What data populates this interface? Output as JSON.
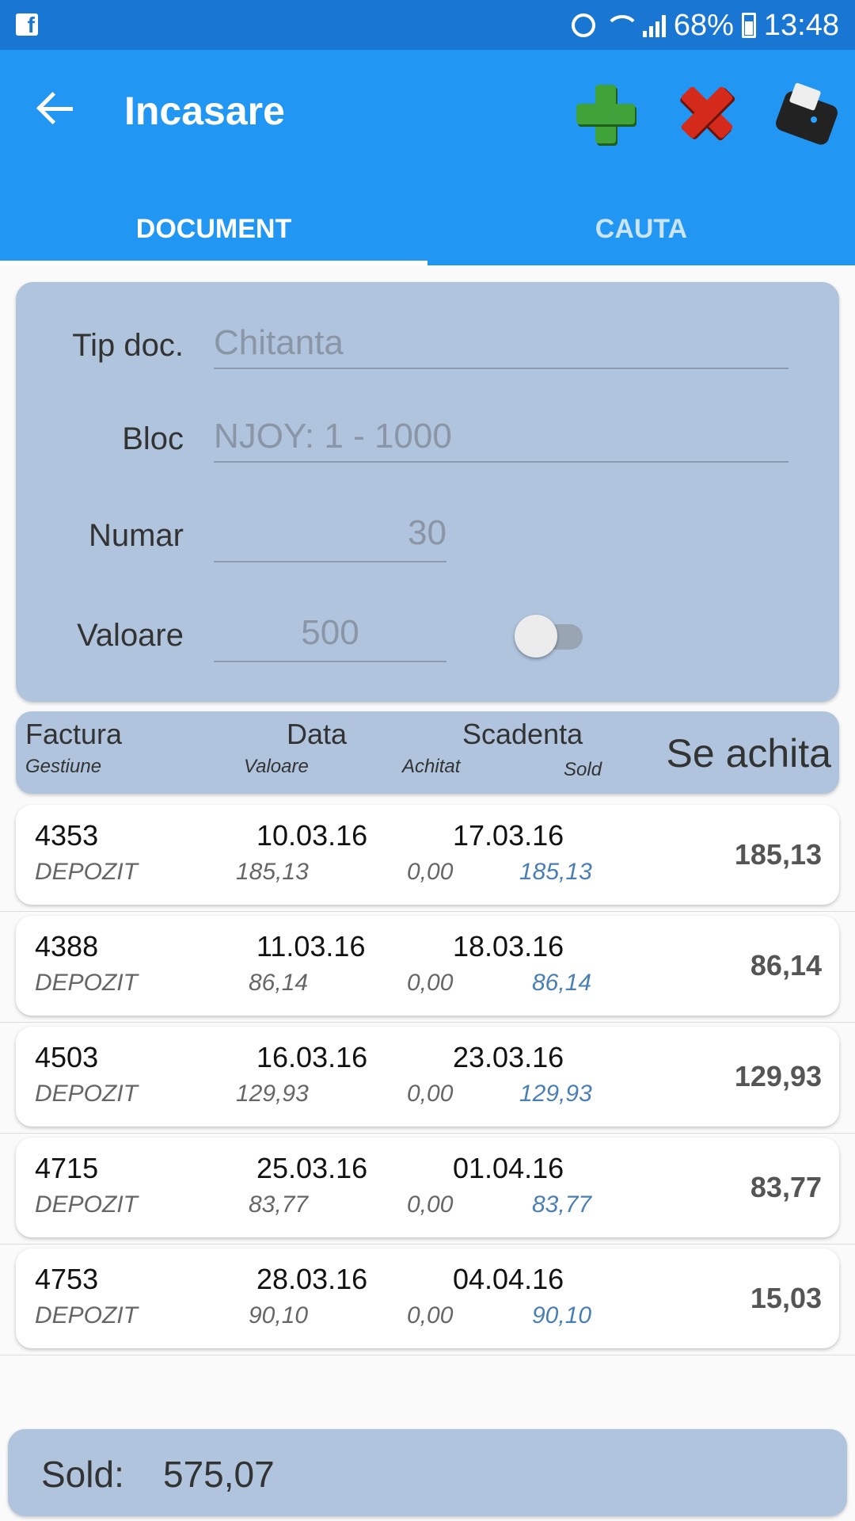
{
  "status_bar": {
    "battery": "68%",
    "time": "13:48"
  },
  "app_bar": {
    "title": "Incasare"
  },
  "tabs": [
    {
      "label": "DOCUMENT"
    },
    {
      "label": "CAUTA"
    }
  ],
  "form": {
    "tip_doc": {
      "label": "Tip doc.",
      "value": "Chitanta"
    },
    "bloc": {
      "label": "Bloc",
      "value": "NJOY: 1 - 1000"
    },
    "numar": {
      "label": "Numar",
      "value": "30"
    },
    "valoare": {
      "label": "Valoare",
      "value": "500"
    }
  },
  "list_header": {
    "factura": "Factura",
    "gestiune": "Gestiune",
    "data": "Data",
    "valoare": "Valoare",
    "scadenta": "Scadenta",
    "achitat": "Achitat",
    "sold": "Sold",
    "se_achita": "Se achita"
  },
  "rows": [
    {
      "factura": "4353",
      "gestiune": "DEPOZIT",
      "data": "10.03.16",
      "valoare": "185,13",
      "scadenta": "17.03.16",
      "achitat": "0,00",
      "sold": "185,13",
      "se_achita": "185,13"
    },
    {
      "factura": "4388",
      "gestiune": "DEPOZIT",
      "data": "11.03.16",
      "valoare": "86,14",
      "scadenta": "18.03.16",
      "achitat": "0,00",
      "sold": "86,14",
      "se_achita": "86,14"
    },
    {
      "factura": "4503",
      "gestiune": "DEPOZIT",
      "data": "16.03.16",
      "valoare": "129,93",
      "scadenta": "23.03.16",
      "achitat": "0,00",
      "sold": "129,93",
      "se_achita": "129,93"
    },
    {
      "factura": "4715",
      "gestiune": "DEPOZIT",
      "data": "25.03.16",
      "valoare": "83,77",
      "scadenta": "01.04.16",
      "achitat": "0,00",
      "sold": "83,77",
      "se_achita": "83,77"
    },
    {
      "factura": "4753",
      "gestiune": "DEPOZIT",
      "data": "28.03.16",
      "valoare": "90,10",
      "scadenta": "04.04.16",
      "achitat": "0,00",
      "sold": "90,10",
      "se_achita": "15,03"
    }
  ],
  "footer": {
    "label": "Sold:",
    "value": "575,07"
  }
}
